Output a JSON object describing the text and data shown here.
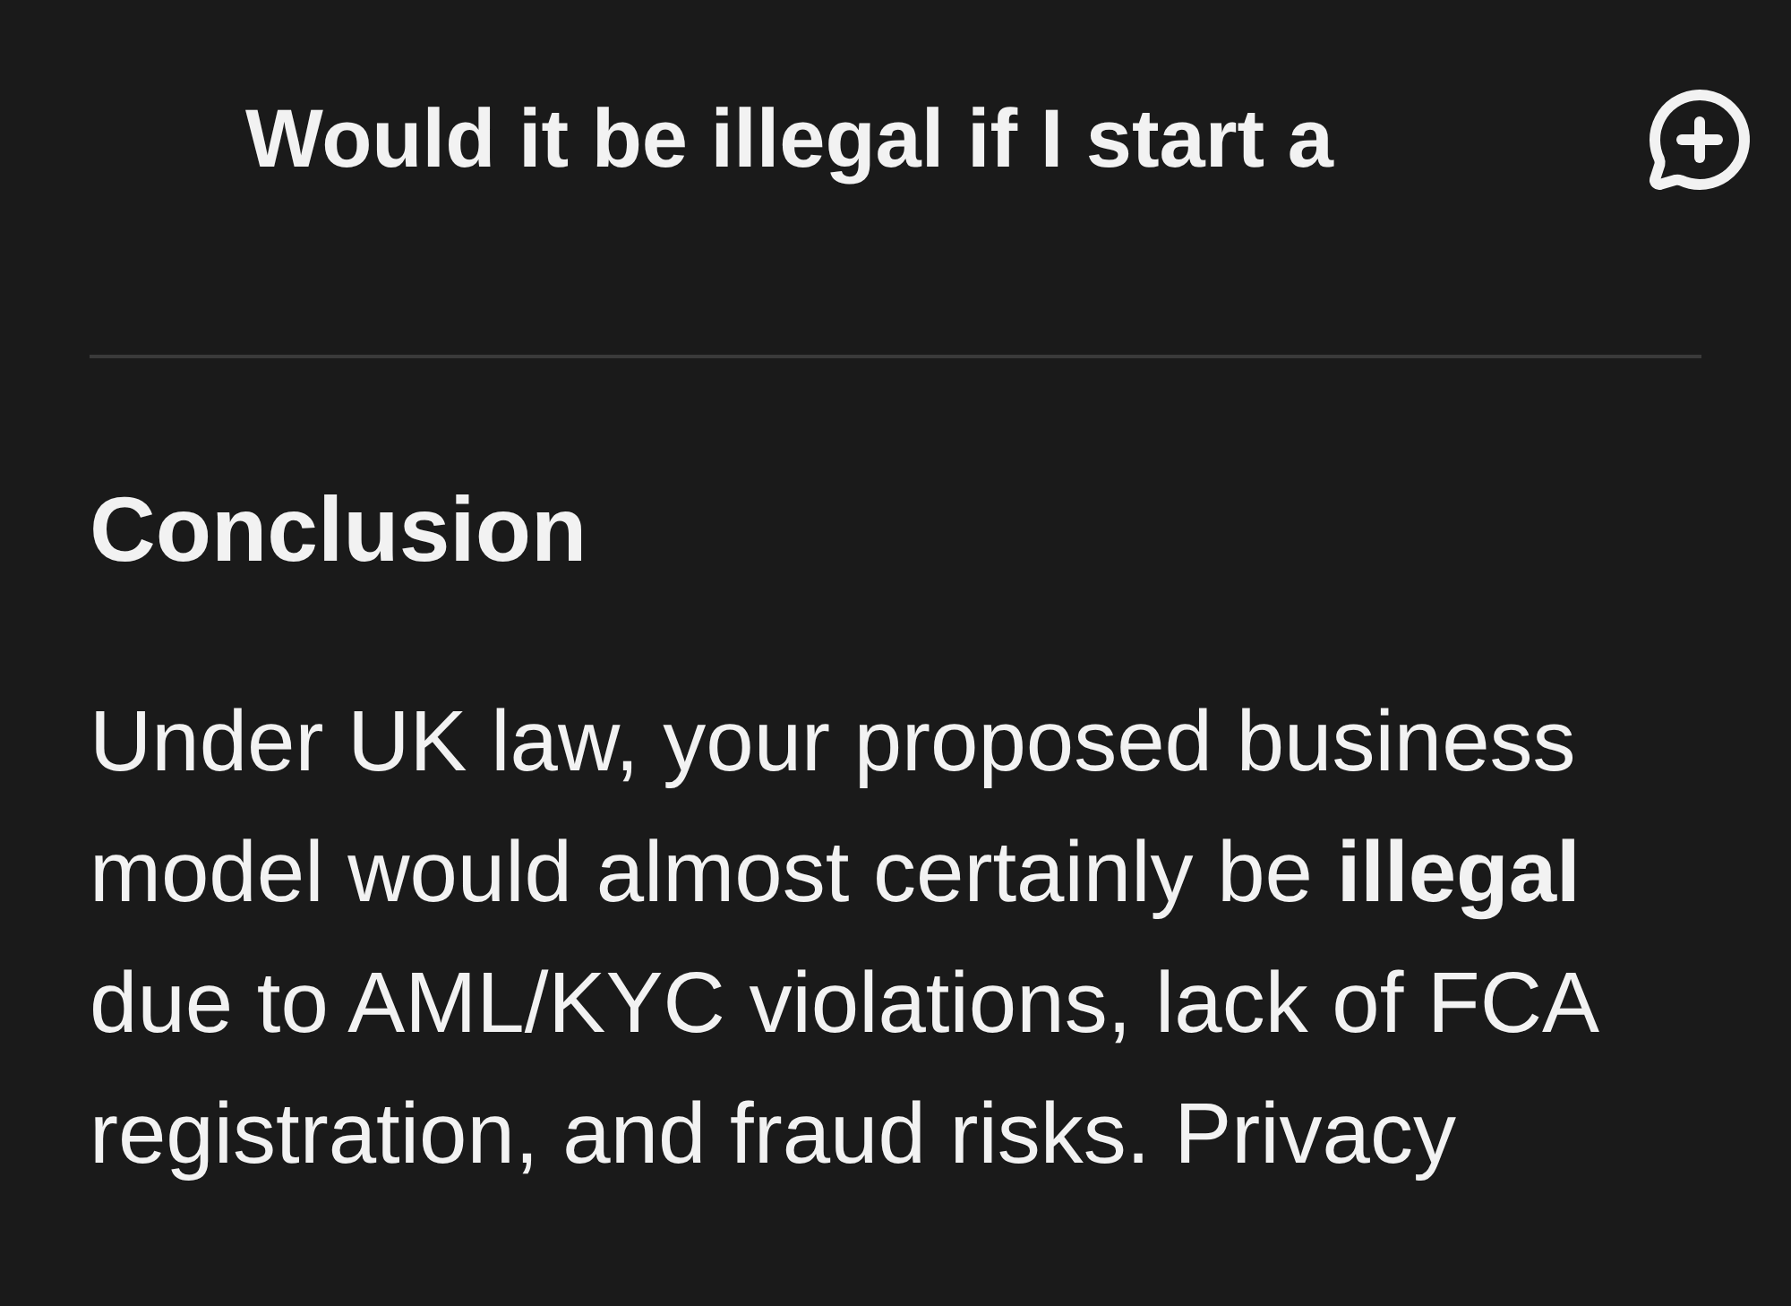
{
  "header": {
    "title": "Would it be illegal if I start a"
  },
  "section": {
    "heading": "Conclusion",
    "paragraph": "Under UK law, your proposed business model would almost certainly be **illegal** due to AML/KYC violations, lack of FCA registration, and fraud risks. Privacy"
  }
}
